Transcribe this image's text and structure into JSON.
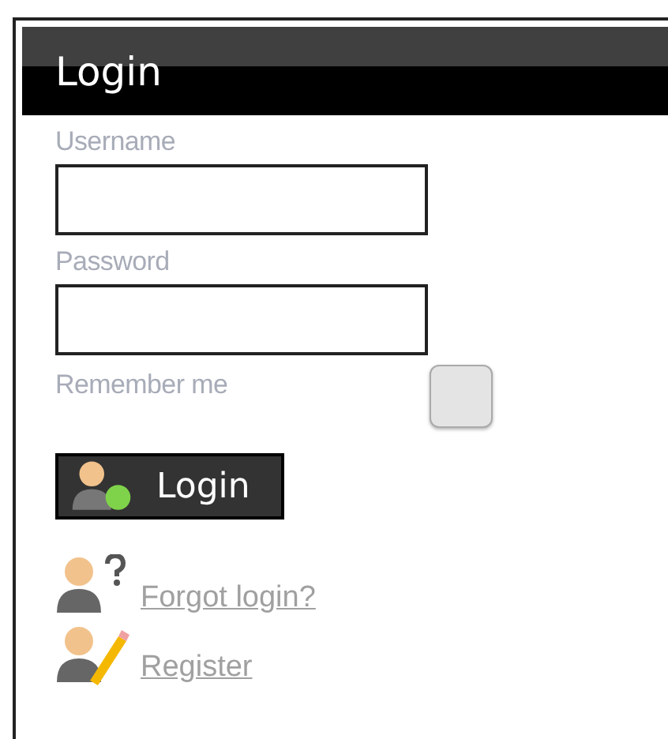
{
  "title": "Login",
  "fields": [
    {
      "label": "Username"
    },
    {
      "label": "Password"
    }
  ],
  "remember": {
    "label": "Remember me",
    "checked": false
  },
  "login_button": "Login",
  "links": [
    {
      "label": "Forgot login?",
      "kind": "forgot"
    },
    {
      "label": "Register",
      "kind": "register"
    }
  ]
}
